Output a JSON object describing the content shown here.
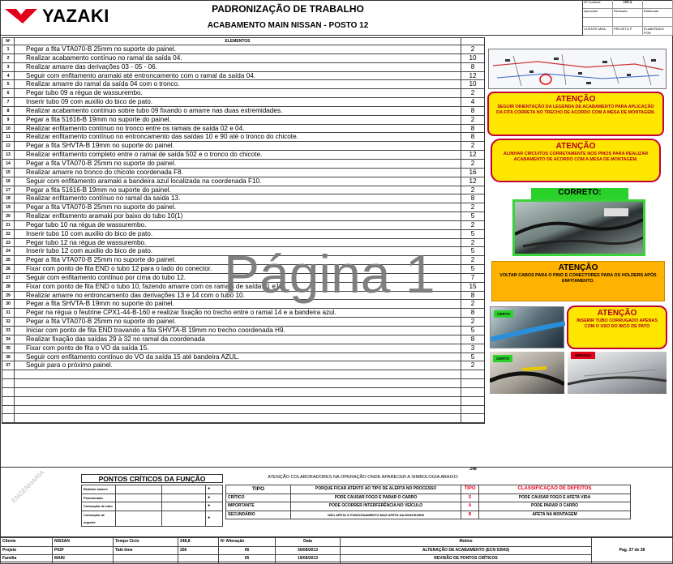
{
  "header": {
    "brand": "YAZAKI",
    "title": "PADRONIZAÇÃO DE TRABALHO",
    "subtitle": "ACABAMENTO MAIN NISSAN -  POSTO 12",
    "doc_number": "581",
    "doc_labels": [
      "Nº Controle",
      "Aprovado",
      "Revisado",
      "Elaborado",
      "CLIENTE MNA",
      "PROJETO P",
      "ELABORADO POR"
    ]
  },
  "table": {
    "header_label": "ELEMENTOS",
    "rows": [
      {
        "n": "1",
        "text": "Pegar a fita VTA070-B 25mm no suporte do painel.",
        "t": "2"
      },
      {
        "n": "2",
        "text": "Realizar acabamento contínuo no ramal da saída 04.",
        "t": "10"
      },
      {
        "n": "3",
        "text": "Realizar amarre das derivações 03 - 05 - 06.",
        "t": "8"
      },
      {
        "n": "4",
        "text": "Seguir com enfitamento aramaki até entroncamento com o ramal da saída 04.",
        "t": "12"
      },
      {
        "n": "5",
        "text": "Realizar amarre do ramal da saída 04 com o tronco.",
        "t": "10"
      },
      {
        "n": "6",
        "text": "Pegar tubo 09 a régua de wassurembo.",
        "t": "2"
      },
      {
        "n": "7",
        "text": "Inserir tubo 09 com auxilio do bico de pato.",
        "t": "4"
      },
      {
        "n": "8",
        "text": "Realizar acabamento contínuo sobre tubo 09 fixando o amarre nas duas extremidades.",
        "t": "8"
      },
      {
        "n": "9",
        "text": "Pegar a fita 51616-B 19mm no suporte do painel.",
        "t": "2"
      },
      {
        "n": "10",
        "text": "Realizar enfitamento contínuo no tronco entre os ramais de saída 02 e 04.",
        "t": "8"
      },
      {
        "n": "11",
        "text": "Realizar enfitamento contínuo no entroncamento das saídas 10 e 90  até o tronco do chicote.",
        "t": "8"
      },
      {
        "n": "12",
        "text": "Pegar a fita SHVTA-B 19mm no suporte do painel.",
        "t": "2"
      },
      {
        "n": "13",
        "text": "Realizar enfitamento completo entre o ramal de saída 502 e o tronco do chicote.",
        "t": "12"
      },
      {
        "n": "14",
        "text": "Pegar a fita VTA070-B 25mm no suporte do painel.",
        "t": "2"
      },
      {
        "n": "15",
        "text": "Realizar amarre no tronco do chicote coordenada F8.",
        "t": "16"
      },
      {
        "n": "16",
        "text": "Seguir com enfitamento aramaki  a bandeira azul localizada na coordenada F10.",
        "t": "12"
      },
      {
        "n": "17",
        "text": "Pegar a fita 51616-B 19mm no suporte do painel.",
        "t": "2"
      },
      {
        "n": "18",
        "text": "Realizar enfitamento contínuo no ramal da saída 13.",
        "t": "8"
      },
      {
        "n": "19",
        "text": "Pegar a fita VTA070-B 25mm no suporte do painel.",
        "t": "2"
      },
      {
        "n": "20",
        "text": "Realizar enfitamento aramaki por baixo do tubo 10(1)",
        "t": "5"
      },
      {
        "n": "21",
        "text": "Pegar tubo 10 na régua de wassurembo.",
        "t": "2"
      },
      {
        "n": "22",
        "text": "Inserir tubo 10 com auxilio do bico de pato.",
        "t": "5"
      },
      {
        "n": "23",
        "text": "Pegar tubo 12 na régua de wassurembo.",
        "t": "2"
      },
      {
        "n": "24",
        "text": "Inserir tubo 12 com auxilio do bico de pato.",
        "t": "5"
      },
      {
        "n": "25",
        "text": "Pegar a fita VTA070-B 25mm no suporte do painel.",
        "t": "2"
      },
      {
        "n": "26",
        "text": "Fixar com ponto de fita END o tubo 12 para o lado do conector.",
        "t": "5"
      },
      {
        "n": "27",
        "text": "Seguir com enfitamento contínuo por cima do tubo 12.",
        "t": "7"
      },
      {
        "n": "28",
        "text": "Fixar com ponto de fita END o tubo 10, fazendo amarre com os ramais de saída 11 e12.",
        "t": "15"
      },
      {
        "n": "29",
        "text": "Realizar amarre no entroncamento das derivações 13 e 14 com o tubo 10.",
        "t": "8"
      },
      {
        "n": "30",
        "text": "Pegar a fita SHVTA-B 19mm no suporte do painel.",
        "t": "2"
      },
      {
        "n": "31",
        "text": "Pegar na régua o feutrine CPX1-44-B-160  e realizar fixação no trecho entre o ramal 14 e a bandeira azul.",
        "t": "8"
      },
      {
        "n": "32",
        "text": "Pegar a fita VTA070-B 25mm no suporte do painel.",
        "t": "2"
      },
      {
        "n": "33",
        "text": "Iniciar com ponto de fita END travando a fita SHVTA-B 19mm no trecho coordenada H9.",
        "t": "5"
      },
      {
        "n": "34",
        "text": "Realizar fixação das saídas 29 à 32 no ramal da coordenada",
        "t": "8"
      },
      {
        "n": "35",
        "text": "Fixar com ponto de fita o VO da saída 15.",
        "t": "3"
      },
      {
        "n": "36",
        "text": "Seguir com enfitamento contínuo do VO da saída 15 até bandeira AZUL.",
        "t": "5"
      },
      {
        "n": "37",
        "text": "Seguir para o próximo painel.",
        "t": "2"
      },
      {
        "n": "",
        "text": "",
        "t": ""
      },
      {
        "n": "",
        "text": "",
        "t": ""
      },
      {
        "n": "",
        "text": "",
        "t": ""
      },
      {
        "n": "",
        "text": "",
        "t": ""
      },
      {
        "n": "",
        "text": "",
        "t": ""
      },
      {
        "n": "",
        "text": "",
        "t": ""
      }
    ],
    "total": "248"
  },
  "watermark": "Página 1",
  "right_panel": {
    "attn1": {
      "title": "ATENÇÃO",
      "text": "SEGUIR ORIENTAÇÃO DA LEGENDA DE ACABAMENTO PARA APLICAÇÃO DA FITA CORRETA NO TRECHO DE ACORDO COM A MESA DE MONTAGEM."
    },
    "attn2": {
      "title": "ATENÇÃO",
      "text": "ALINHAR CIRCUITOS CORRETAMENTE NOS PINOS PARA REALIZAR ACABAMENTO DE ACORDO COM A MESA DE MONTAGEM."
    },
    "correct_label": "CORRETO:",
    "attn3": {
      "title": "ATENÇÃO",
      "text": "VOLTAR CABOS PARA O PINO E CONECTORES PARA OS HOLDERS APÓS ENFITAMENTO."
    },
    "certo1": "CERTO",
    "attn4": {
      "title": "ATENÇÃO",
      "text": "INSERIR TUBO CORRUGADO APENAS COM O USO DO BICO DE PATO"
    },
    "certo2": "CERTO",
    "errado": "ERRADO"
  },
  "critical": {
    "title": "PONTOS CRÍTICOS DA FUNÇÃO",
    "notice": "ATENÇÃO COLABORADORES NA OPERAÇÃO ONDE APARECER A SIMBOLOGIA ABAIXO:",
    "col_tipo": "TIPO",
    "col_why": "PORQUE FICAR ATENTO AO TIPO DE ALERTA NO PROCESSO",
    "col_tipo2": "TIPO",
    "col_class": "CLASSIFICAÇÃO DE DEFEITOS",
    "rows": [
      {
        "tipo": "CRÍTICO",
        "why": "PODE CAUSAR FOGO E PARAR O CARRO",
        "letter": "S",
        "class": "PODE CAUSAR FOGO E AFETA VIDA"
      },
      {
        "tipo": "IMPORTANTE",
        "why": "PODE OCORRER INTERFERÊNCIA NO VEÍCULO",
        "letter": "A",
        "class": "PODE PARAR O CARRO"
      },
      {
        "tipo": "SECUNDÁRIO",
        "why": "NÃO AFETA O FUNCIONAMENTO MAS AFETA NA MONTAGEM",
        "letter": "B",
        "class": "AFETA NA MONTAGEM"
      }
    ],
    "left_labels": [
      "Realizar amarre",
      "Posicionado",
      "Colocação de tubo",
      "Colocação de suporte"
    ],
    "stamp": "ENGENHARIA"
  },
  "footer": {
    "rows": [
      {
        "k1": "Cliente",
        "v1": "NISSAN",
        "k2": "Tempo Ciclo",
        "v2": "248,8",
        "k3": "Nº Alteração",
        "k4": "Data",
        "k5": "Motivo"
      },
      {
        "k1": "Projeto",
        "v1": "P02F",
        "k2": "Takt time",
        "v2": "256",
        "v3": "06",
        "v4": "30/08/2013",
        "v5": "ALTERAÇÃO DE ACABAMENTO (ECN 53943)"
      },
      {
        "k1": "Família",
        "v1": "MAIN",
        "k2": "",
        "v2": "",
        "v3": "05",
        "v4": "19/08/2013",
        "v5": "REVISÃO DE PONTOS CRÍTICOS"
      }
    ],
    "page": "Pag. 27 de 38"
  }
}
